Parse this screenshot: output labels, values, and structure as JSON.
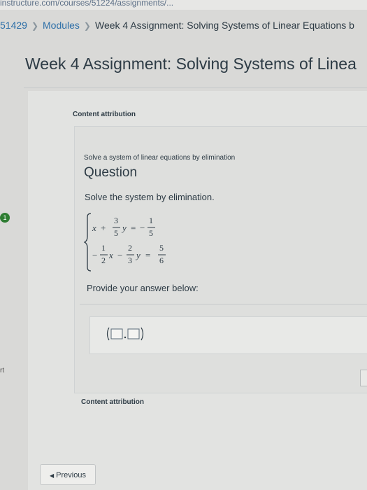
{
  "browser": {
    "url": "instructure.com/courses/51224/assignments/..."
  },
  "breadcrumb": {
    "course": "51429",
    "modules": "Modules",
    "current": "Week 4 Assignment: Solving Systems of Linear Equations b"
  },
  "page": {
    "title": "Week 4 Assignment: Solving Systems of Linea"
  },
  "question": {
    "content_attribution_top": "Content attribution",
    "subtitle": "Solve a system of linear equations by elimination",
    "heading": "Question",
    "prompt": "Solve the system by elimination.",
    "eq1": {
      "var_x": "x",
      "plus": "+",
      "coef_num": "3",
      "coef_den": "5",
      "var_y": "y",
      "equals": "=",
      "minus": "−",
      "rhs_num": "1",
      "rhs_den": "5"
    },
    "eq2": {
      "lead_minus": "−",
      "coef_x_num": "1",
      "coef_x_den": "2",
      "var_x": "x",
      "minus": "−",
      "coef_y_num": "2",
      "coef_y_den": "3",
      "var_y": "y",
      "equals": "=",
      "rhs_num": "5",
      "rhs_den": "6"
    },
    "provide_label": "Provide your answer below:",
    "content_attribution_bottom": "Content attribution"
  },
  "side": {
    "badge": "1",
    "label": "rt"
  },
  "nav": {
    "previous_label": "Previous"
  },
  "colors": {
    "link": "#2d6fa8",
    "text": "#2d3b45",
    "badge": "#2e7d32"
  }
}
